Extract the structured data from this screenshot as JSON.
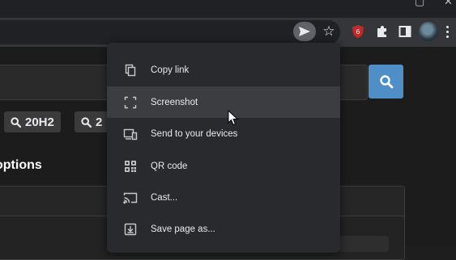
{
  "toolbar": {
    "extension_badge": "6"
  },
  "page": {
    "chips": [
      {
        "label": "20H2"
      },
      {
        "label": "2"
      }
    ],
    "heading": "options"
  },
  "share_menu": {
    "items": [
      {
        "label": "Copy link",
        "icon": "copy-icon"
      },
      {
        "label": "Screenshot",
        "icon": "screenshot-icon"
      },
      {
        "label": "Send to your devices",
        "icon": "devices-icon"
      },
      {
        "label": "QR code",
        "icon": "qr-code-icon"
      },
      {
        "label": "Cast...",
        "icon": "cast-icon"
      },
      {
        "label": "Save page as...",
        "icon": "download-icon"
      }
    ]
  },
  "colors": {
    "accent": "#4f8ec7",
    "menu_bg": "#292a2d",
    "menu_hover": "#3c3d40",
    "toolbar_bg": "#35363a",
    "extension_red": "#c62828"
  }
}
